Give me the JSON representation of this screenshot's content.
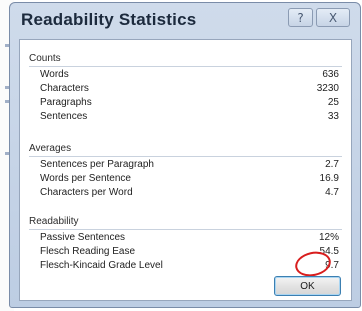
{
  "dialog": {
    "title": "Readability Statistics",
    "help_glyph": "?",
    "close_glyph": "X"
  },
  "counts": {
    "header": "Counts",
    "rows": [
      {
        "label": "Words",
        "value": "636"
      },
      {
        "label": "Characters",
        "value": "3230"
      },
      {
        "label": "Paragraphs",
        "value": "25"
      },
      {
        "label": "Sentences",
        "value": "33"
      }
    ]
  },
  "averages": {
    "header": "Averages",
    "rows": [
      {
        "label": "Sentences per Paragraph",
        "value": "2.7"
      },
      {
        "label": "Words per Sentence",
        "value": "16.9"
      },
      {
        "label": "Characters per Word",
        "value": "4.7"
      }
    ]
  },
  "readability": {
    "header": "Readability",
    "rows": [
      {
        "label": "Passive Sentences",
        "value": "12%"
      },
      {
        "label": "Flesch Reading Ease",
        "value": "54.5"
      },
      {
        "label": "Flesch-Kincaid Grade Level",
        "value": "9.7"
      }
    ]
  },
  "buttons": {
    "ok": "OK"
  },
  "annotation": {
    "color": "#d81e1e",
    "target": "Flesch-Kincaid Grade Level"
  },
  "colors": {
    "title_text": "#1c2a3d",
    "frame": "#bdcde3",
    "ok_border": "#3c7fb1"
  }
}
